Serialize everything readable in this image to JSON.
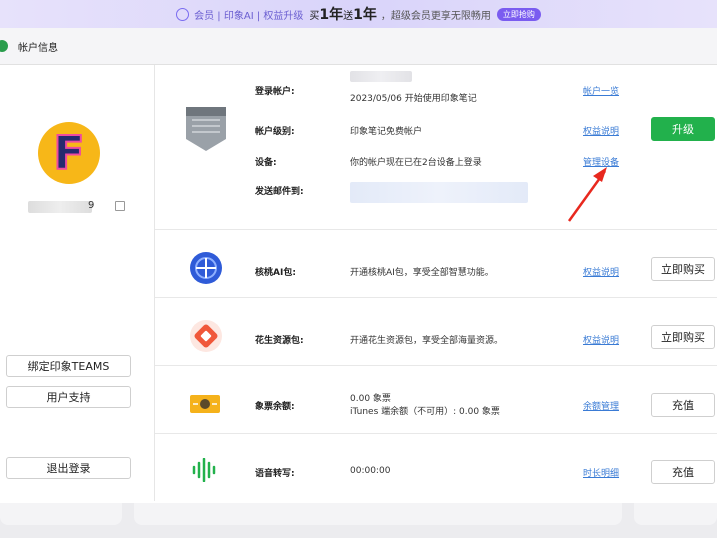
{
  "banner": {
    "text1": "会员 | 印象AI | 权益升级",
    "text2": "买",
    "big1": "1年",
    "text3": "送",
    "big2": "1年",
    "text4": "，超级会员更享无限畅用",
    "button": "立即抢购"
  },
  "window": {
    "title": "帐户信息"
  },
  "profile": {
    "avatar_letter": "F",
    "username_suffix": "9",
    "buttons": {
      "bind_teams": "绑定印象TEAMS",
      "support": "用户支持",
      "logout": "退出登录"
    }
  },
  "account": {
    "login_label": "登录帐户:",
    "login_since": "2023/05/06 开始使用印象笔记",
    "overview_link": "帐户一览",
    "level_label": "帐户级别:",
    "level_value": "印象笔记免费帐户",
    "rights_link": "权益说明",
    "upgrade_button": "升级",
    "device_label": "设备:",
    "device_value": "你的帐户现在已在2台设备上登录",
    "manage_devices_link": "管理设备",
    "email_label": "发送邮件到:"
  },
  "ai_pack": {
    "label": "核桃AI包:",
    "desc": "开通核桃AI包，享受全部智慧功能。",
    "link": "权益说明",
    "button": "立即购买"
  },
  "peanut_pack": {
    "label": "花生资源包:",
    "desc": "开通花生资源包，享受全部海量资源。",
    "link": "权益说明",
    "button": "立即购买"
  },
  "balance": {
    "label": "象票余额:",
    "value1": "0.00 象票",
    "value2": "iTunes 端余额（不可用）: 0.00 象票",
    "link": "余额管理",
    "button": "充值"
  },
  "voice": {
    "label": "语音转写:",
    "value": "00:00:00",
    "link": "时长明细",
    "button": "充值"
  },
  "colors": {
    "accent_green": "#22b14c",
    "link_blue": "#3a7bd5",
    "annotation_red": "#e8281e"
  }
}
